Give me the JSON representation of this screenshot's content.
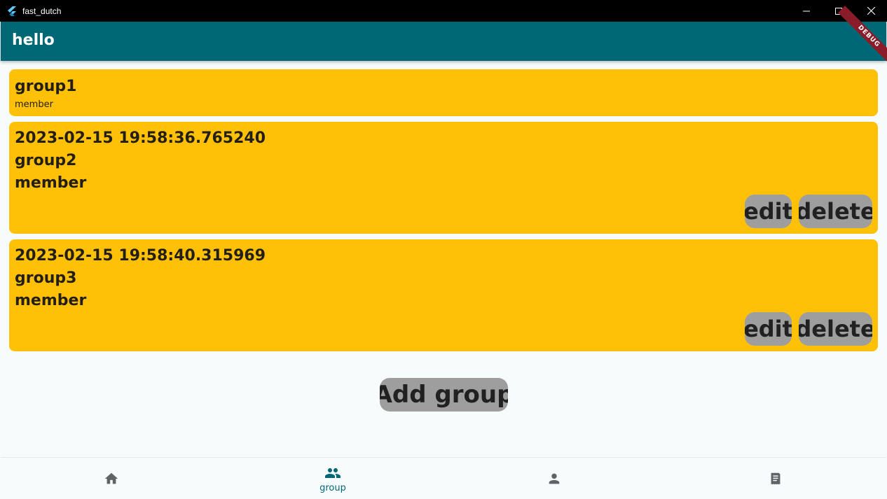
{
  "window": {
    "title": "fast_dutch"
  },
  "appbar": {
    "title": "hello",
    "debug_banner": "DEBUG"
  },
  "groups": [
    {
      "name": "group1",
      "member": "member"
    },
    {
      "timestamp": "2023-02-15 19:58:36.765240",
      "name": "group2",
      "member": "member",
      "edit_label": "edit",
      "delete_label": "delete"
    },
    {
      "timestamp": "2023-02-15 19:58:40.315969",
      "name": "group3",
      "member": "member",
      "edit_label": "edit",
      "delete_label": "delete"
    }
  ],
  "add_group_label": "Add group",
  "bottom_nav": {
    "items": [
      {
        "icon": "home-icon",
        "label": ""
      },
      {
        "icon": "group-icon",
        "label": "group",
        "selected": true
      },
      {
        "icon": "person-icon",
        "label": ""
      },
      {
        "icon": "receipt-icon",
        "label": ""
      }
    ]
  },
  "colors": {
    "appbar": "#006874",
    "card": "#ffc107",
    "button": "#9e9e9e",
    "nav_selected": "#006874",
    "nav_unselected": "#5f6368"
  }
}
